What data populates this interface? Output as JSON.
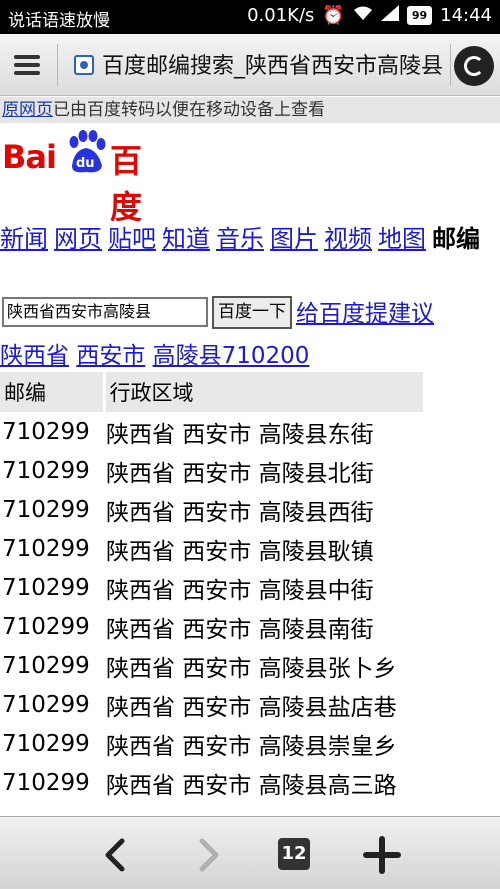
{
  "status_bar": {
    "left_text": "说话语速放慢",
    "network_speed": "0.01K/s",
    "battery": "99",
    "time": "14:44",
    "icons": [
      "alarm-icon",
      "wifi-icon",
      "signal-icon",
      "battery-icon"
    ]
  },
  "toolbar": {
    "title": "百度邮编搜索_陕西省西安市高陵县"
  },
  "notice": {
    "link": "原网页",
    "text": "已由百度转码以便在移动设备上查看"
  },
  "logo": {
    "text_left": "Bai",
    "text_paw": "du",
    "text_right": "百度"
  },
  "nav": {
    "items": [
      "新闻",
      "网页",
      "贴吧",
      "知道",
      "音乐",
      "图片",
      "视频",
      "地图"
    ],
    "current": "邮编"
  },
  "search": {
    "value": "陕西省西安市高陵县",
    "button": "百度一下",
    "suggest": "给百度提建议"
  },
  "breadcrumb": {
    "province": "陕西省",
    "city": "西安市",
    "county_code": "高陵县710200"
  },
  "table": {
    "headers": [
      "邮编",
      "行政区域"
    ],
    "rows": [
      [
        "710299",
        "陕西省 西安市 高陵县东街"
      ],
      [
        "710299",
        "陕西省 西安市 高陵县北街"
      ],
      [
        "710299",
        "陕西省 西安市 高陵县西街"
      ],
      [
        "710299",
        "陕西省 西安市 高陵县耿镇"
      ],
      [
        "710299",
        "陕西省 西安市 高陵县中街"
      ],
      [
        "710299",
        "陕西省 西安市 高陵县南街"
      ],
      [
        "710299",
        "陕西省 西安市 高陵县张卜乡"
      ],
      [
        "710299",
        "陕西省 西安市 高陵县盐店巷"
      ],
      [
        "710299",
        "陕西省 西安市 高陵县崇皇乡"
      ],
      [
        "710299",
        "陕西省 西安市 高陵县高三路"
      ]
    ]
  },
  "bottom_bar": {
    "tab_count": "12"
  }
}
